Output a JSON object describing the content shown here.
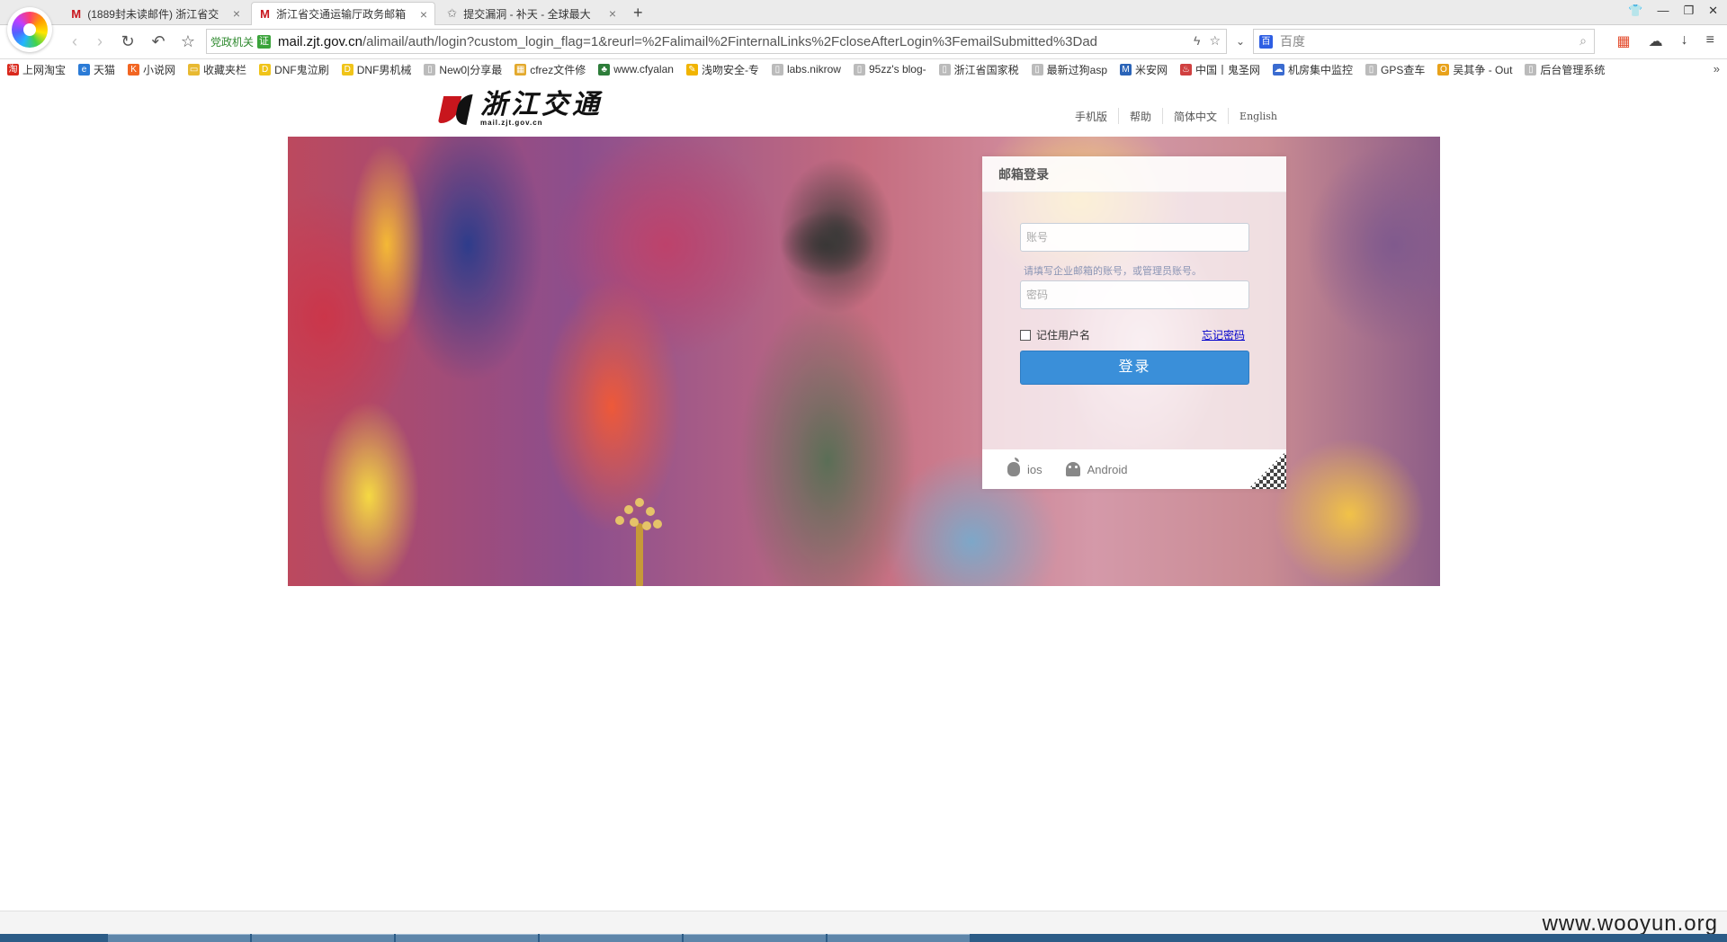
{
  "browser": {
    "tabs": [
      {
        "favicon": "M",
        "title": "(1889封未读邮件) 浙江省交",
        "close": "×"
      },
      {
        "favicon": "M",
        "title": "浙江省交通运输厅政务邮箱",
        "close": "×"
      },
      {
        "favicon": "✩",
        "title": "提交漏洞 - 补天 - 全球最大",
        "close": "×"
      }
    ],
    "new_tab": "+",
    "cert_label": "党政机关",
    "cert_icon_text": "证",
    "url_host": "mail.zjt.gov.cn",
    "url_path": "/alimail/auth/login?custom_login_flag=1&reurl=%2Falimail%2FinternalLinks%2FcloseAfterLogin%3FemailSubmitted%3Dad",
    "search_placeholder": "百度"
  },
  "bookmarks": [
    {
      "label": "上网淘宝",
      "color": "#d9281c",
      "glyph": "淘"
    },
    {
      "label": "天猫",
      "color": "#2b7bd6",
      "glyph": "e"
    },
    {
      "label": "小说网",
      "color": "#f26522",
      "glyph": "K"
    },
    {
      "label": "收藏夹栏",
      "color": "#e8b931",
      "glyph": "▭"
    },
    {
      "label": "DNF鬼泣刷",
      "color": "#f0c419",
      "glyph": "D"
    },
    {
      "label": "DNF男机械",
      "color": "#f0c419",
      "glyph": "D"
    },
    {
      "label": "New0|分享最",
      "color": "#bbbbbb",
      "glyph": "▯"
    },
    {
      "label": "cfrez文件修",
      "color": "#e3a92c",
      "glyph": "▦"
    },
    {
      "label": "www.cfyalan",
      "color": "#2d7d3a",
      "glyph": "♣"
    },
    {
      "label": "浅吻安全-专",
      "color": "#f1b400",
      "glyph": "✎"
    },
    {
      "label": "labs.nikrow",
      "color": "#bbbbbb",
      "glyph": "▯"
    },
    {
      "label": "95zz's blog-",
      "color": "#bbbbbb",
      "glyph": "▯"
    },
    {
      "label": "浙江省国家税",
      "color": "#bbbbbb",
      "glyph": "▯"
    },
    {
      "label": "最新过狗asp",
      "color": "#bbbbbb",
      "glyph": "▯"
    },
    {
      "label": "米安网",
      "color": "#2b64b8",
      "glyph": "M"
    },
    {
      "label": "中国丨鬼圣网",
      "color": "#d04040",
      "glyph": "♨"
    },
    {
      "label": "机房集中监控",
      "color": "#3a6bd0",
      "glyph": "☁"
    },
    {
      "label": "GPS查车",
      "color": "#bbbbbb",
      "glyph": "▯"
    },
    {
      "label": "吴其争 - Out",
      "color": "#e8a21b",
      "glyph": "O"
    },
    {
      "label": "后台管理系统",
      "color": "#bbbbbb",
      "glyph": "▯"
    }
  ],
  "site": {
    "brand_name": "浙江交通",
    "brand_domain": "mail.zjt.gov.cn",
    "top_links": [
      "手机版",
      "帮助",
      "简体中文",
      "English"
    ]
  },
  "login": {
    "title": "邮箱登录",
    "account_placeholder": "账号",
    "account_hint": "请填写企业邮箱的账号，或管理员账号。",
    "password_placeholder": "密码",
    "remember_label": "记住用户名",
    "forgot_label": "忘记密码",
    "submit_label": "登录",
    "apps": {
      "ios": "ios",
      "android": "Android"
    }
  },
  "watermark": "www.wooyun.org"
}
